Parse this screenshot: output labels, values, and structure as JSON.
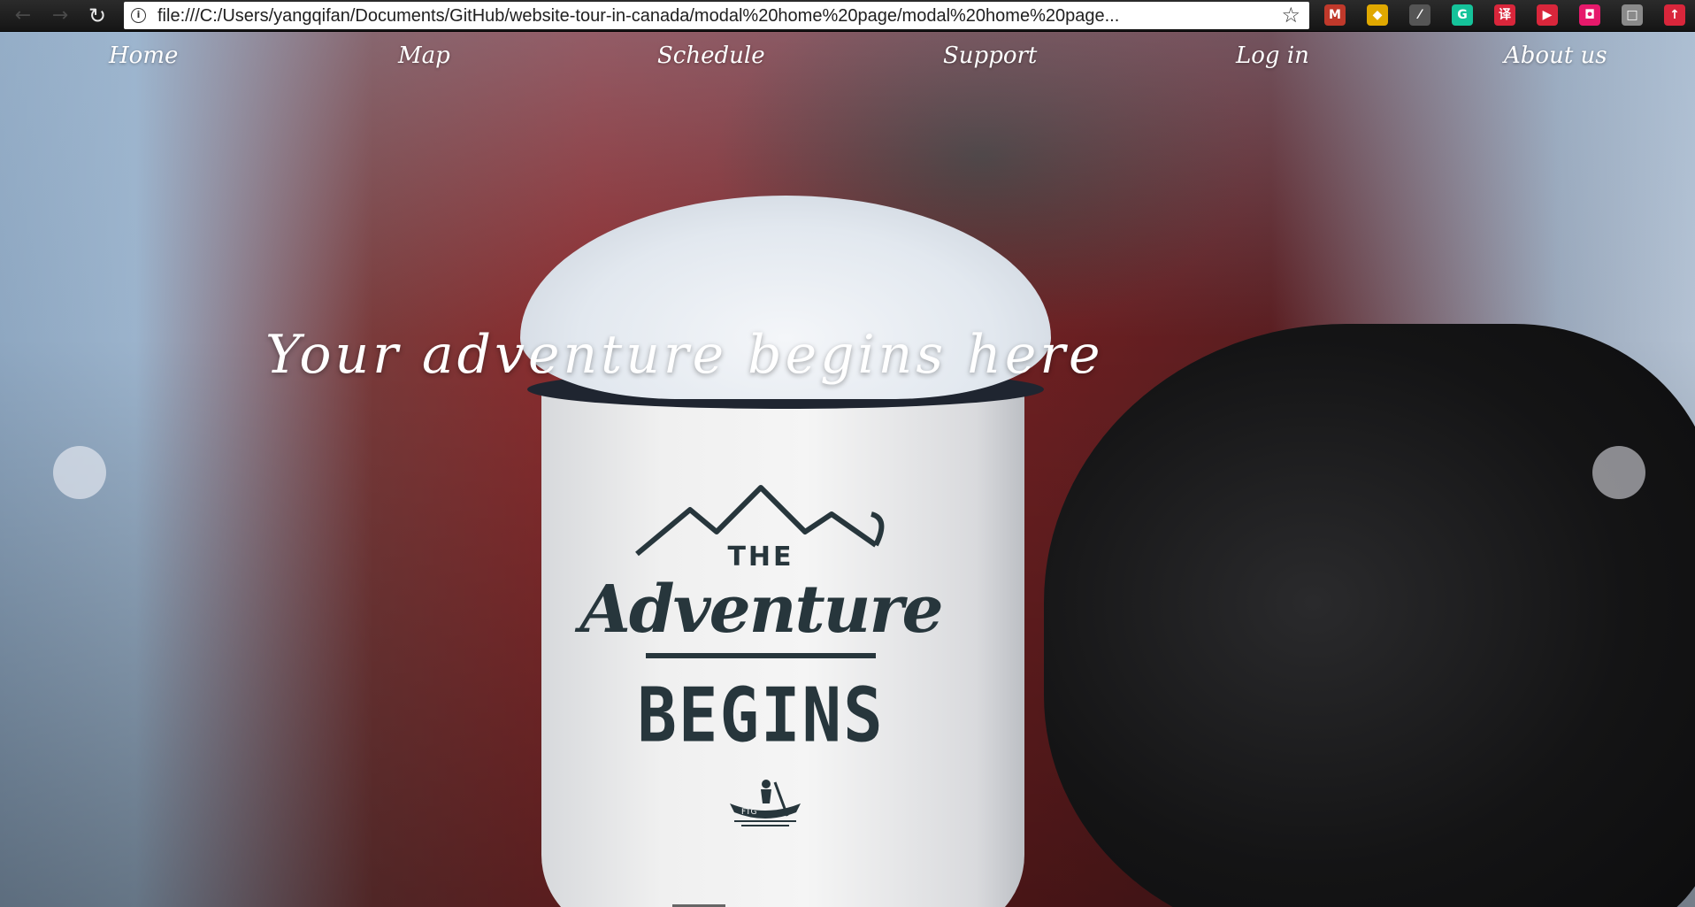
{
  "browser": {
    "url": "file:///C:/Users/yangqifan/Documents/GitHub/website-tour-in-canada/modal%20home%20page/modal%20home%20page...",
    "extensions": [
      {
        "name": "mario-extension-icon",
        "color": "#c0392b",
        "glyph": "M"
      },
      {
        "name": "chrome-web-store-icon",
        "color": "#e0a800",
        "glyph": "◆"
      },
      {
        "name": "pdf-extension-icon",
        "color": "#555555",
        "glyph": "⁄"
      },
      {
        "name": "grammarly-icon",
        "color": "#15c39a",
        "glyph": "G"
      },
      {
        "name": "translate-extension-icon",
        "color": "#d9263b",
        "glyph": "译"
      },
      {
        "name": "video-extension-icon",
        "color": "#d9263b",
        "glyph": "▶"
      },
      {
        "name": "pink-extension-icon",
        "color": "#e6196b",
        "glyph": "◘"
      },
      {
        "name": "gray-extension-icon",
        "color": "#8a8a8a",
        "glyph": "□"
      },
      {
        "name": "upload-extension-icon",
        "color": "#d9263b",
        "glyph": "↑"
      }
    ]
  },
  "nav": {
    "home": "Home",
    "map": "Map",
    "schedule": "Schedule",
    "support": "Support",
    "login": "Log in",
    "about": "About us"
  },
  "hero": {
    "headline": "Your adventure begins here",
    "mug_the": "THE",
    "mug_adventure": "Adventure",
    "mug_begins": "BEGINS",
    "mug_ftg": "FTG"
  },
  "colors": {
    "nav_text": "#ffffff",
    "mug_ink": "#27363c"
  }
}
